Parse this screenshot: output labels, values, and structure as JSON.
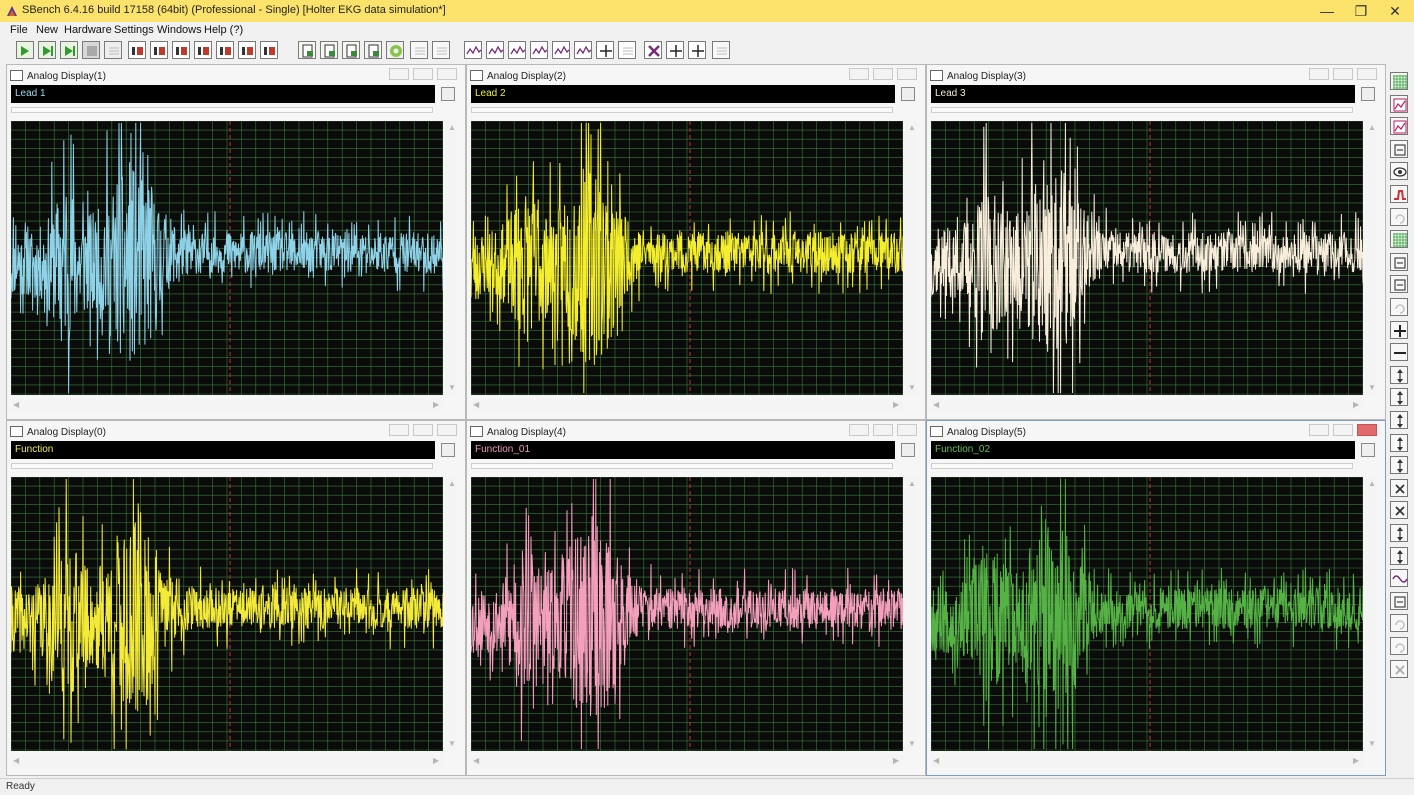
{
  "app": {
    "title": "SBench 6.4.16 build 17158 (64bit) (Professional - Single)    [Holter EKG data simulation*]"
  },
  "window_controls": {
    "minimize": "—",
    "restore": "❐",
    "close": "✕"
  },
  "menu": [
    "File",
    "New",
    "Hardware",
    "Settings",
    "Windows",
    "Help (?)"
  ],
  "toolbar": [
    {
      "icon": "start-icon"
    },
    {
      "icon": "start-continuous-icon"
    },
    {
      "icon": "restart-icon"
    },
    {
      "icon": "stop-icon"
    },
    {
      "icon": "force-trigger-icon"
    },
    {
      "icon": "ok-icon"
    },
    {
      "icon": "channel-settings-icon"
    },
    {
      "icon": "channel-settings-icon"
    },
    {
      "icon": "channel-settings-icon"
    },
    {
      "icon": "channel-settings-icon"
    },
    {
      "icon": "channel-settings-icon"
    },
    {
      "icon": "channel-settings-icon"
    },
    {
      "icon": "export-icon"
    },
    {
      "icon": "import-icon"
    },
    {
      "icon": "export-all-icon"
    },
    {
      "icon": "save-icon"
    },
    {
      "icon": "gear-icon"
    },
    {
      "icon": "blank-icon"
    },
    {
      "icon": "list-icon"
    },
    {
      "icon": "analog-display-icon"
    },
    {
      "icon": "digital-display-icon"
    },
    {
      "icon": "step-display-icon"
    },
    {
      "icon": "spectrum-display-icon"
    },
    {
      "icon": "xy-display-icon"
    },
    {
      "icon": "histogram-icon"
    },
    {
      "icon": "tile-icon"
    },
    {
      "icon": "cascade-icon"
    },
    {
      "icon": "close-all-icon"
    },
    {
      "icon": "tile-vertical-icon"
    },
    {
      "icon": "tile-horizontal-icon"
    },
    {
      "icon": "blank-icon"
    }
  ],
  "right_toolbar": [
    "grid-icon",
    "mdi-icon",
    "chart-icon",
    "measure-icon",
    "eye-icon",
    "red-signal-icon",
    "blank-icon",
    "table-icon",
    "calc-icon",
    "box-icon",
    "arrows-icon",
    "plus-icon",
    "minus-icon",
    "zoom-in-icon",
    "zoom-fit-icon",
    "zoom-h-icon",
    "zoom-v-icon",
    "zoom-v2-icon",
    "cross-icon",
    "cross2-icon",
    "marker-y-icon",
    "marker-y2-icon",
    "wave-icon",
    "numbers-icon",
    "undo-icon",
    "redo-icon",
    "delete-icon"
  ],
  "windows": [
    {
      "id": "win1",
      "title": "Analog Display(1)",
      "label": "Lead 1",
      "label_color": "#9fd8ee",
      "color": "#8fd3e8",
      "seed": 11
    },
    {
      "id": "win2",
      "title": "Analog Display(2)",
      "label": "Lead 2",
      "label_color": "#f0ef40",
      "color": "#f4ee2e",
      "seed": 23
    },
    {
      "id": "win3",
      "title": "Analog Display(3)",
      "label": "Lead 3",
      "label_color": "#f5ead4",
      "color": "#f8eedb",
      "seed": 37
    },
    {
      "id": "win0",
      "title": "Analog Display(0)",
      "label": "Function",
      "label_color": "#f0e860",
      "color": "#f4ea3a",
      "seed": 41
    },
    {
      "id": "win4",
      "title": "Analog Display(4)",
      "label": "Function_01",
      "label_color": "#f29ab4",
      "color": "#f4a0bc",
      "seed": 53
    },
    {
      "id": "win5",
      "title": "Analog Display(5)",
      "label": "Function_02",
      "label_color": "#67c24f",
      "color": "#55b244",
      "seed": 67
    }
  ],
  "status": "Ready"
}
